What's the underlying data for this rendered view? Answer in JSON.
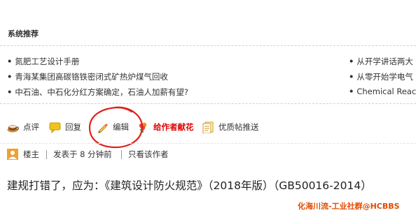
{
  "section": {
    "title": "系统推荐"
  },
  "recommendations": {
    "left": [
      "氮肥工艺设计手册",
      "青海某集团高碳铬铁密闭式矿热炉煤气回收",
      "中石油、中石化分红方案确定，石油人加薪有望?"
    ],
    "right": [
      "从开学讲话两大",
      "从零开始学电气",
      "Chemical Reactio"
    ],
    "bullet": "•"
  },
  "toolbar": {
    "comment_label": "点评",
    "reply_label": "回复",
    "edit_label": "编辑",
    "gift_label": "给作者献花",
    "push_label": "优质帖推送"
  },
  "post": {
    "role": "楼主",
    "posted_time": "发表于 8 分钟前",
    "author_only": "只看该作者",
    "content": "建规打错了，应为：《建筑设计防火规范》（2018年版）（GB50016-2014）"
  },
  "watermark": "化海川流-工业社群@HCBBS",
  "colors": {
    "divider": "#c2d5e3",
    "gift_text": "#e20000",
    "circle_annotation": "#e0201a",
    "watermark": "#e24b00"
  }
}
